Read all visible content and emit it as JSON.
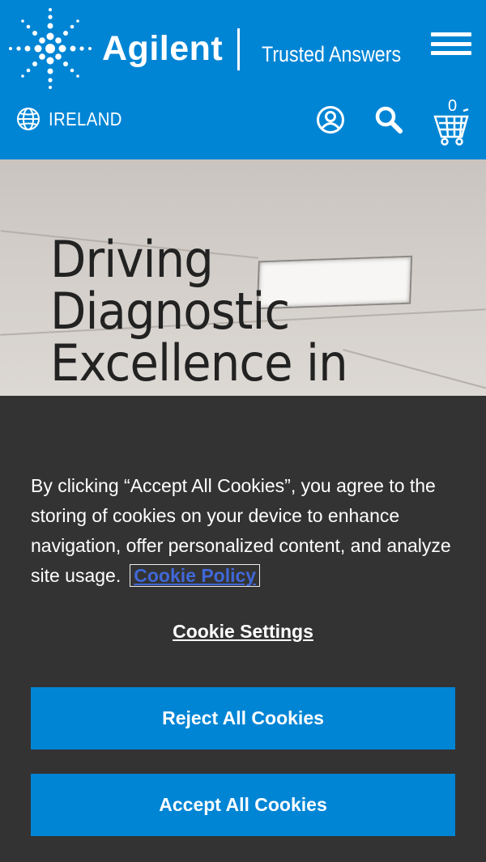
{
  "header": {
    "brand": "Agilent",
    "tagline": "Trusted Answers",
    "region": "IRELAND",
    "cart_count": "0",
    "icons": [
      "spark-logo-icon",
      "menu-icon",
      "globe-icon",
      "user-icon",
      "search-icon",
      "cart-icon"
    ],
    "color": "#0085d5"
  },
  "hero": {
    "title_lines": [
      "Driving",
      "Diagnostic",
      "Excellence in"
    ]
  },
  "cookie_banner": {
    "text": "By clicking “Accept All Cookies”, you agree to the storing of cookies on your device to enhance navigation, offer personalized content, and analyze site usage.",
    "policy_link": "Cookie Policy",
    "settings_label": "Cookie Settings",
    "reject_label": "Reject All Cookies",
    "accept_label": "Accept All Cookies",
    "background": "#333333"
  }
}
